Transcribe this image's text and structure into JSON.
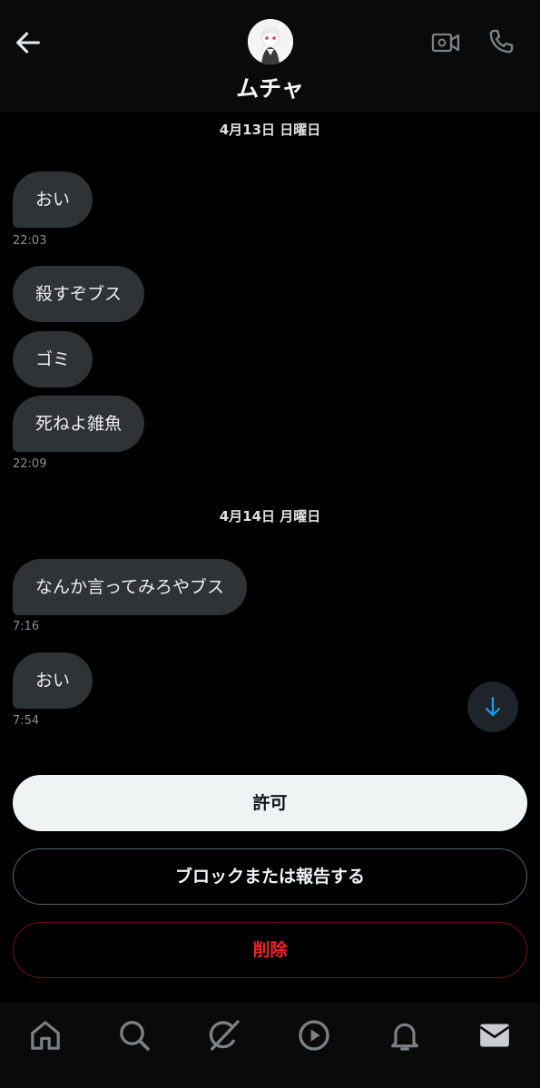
{
  "header": {
    "title": "ムチャ",
    "back_icon": "arrow-left-icon",
    "video_icon": "video-camera-icon",
    "call_icon": "phone-icon"
  },
  "messages": {
    "date1": "4月13日 日曜日",
    "m1": "おい",
    "t1": "22:03",
    "m2": "殺すぞブス",
    "m3": "ゴミ",
    "m4": "死ねよ雑魚",
    "t2": "22:09",
    "date2": "4月14日 月曜日",
    "m5": "なんか言ってみろやブス",
    "t3": "7:16",
    "m6": "おい",
    "t4": "7:54"
  },
  "actions": {
    "allow": "許可",
    "block_report": "ブロックまたは報告する",
    "delete": "削除"
  },
  "nav": [
    "home-icon",
    "search-icon",
    "grok-icon",
    "video-play-icon",
    "bell-icon",
    "mail-icon"
  ],
  "colors": {
    "background": "#000000",
    "bubble": "#2f3336",
    "delete_red": "#f4212e",
    "accent_blue": "#1d9bf0"
  }
}
